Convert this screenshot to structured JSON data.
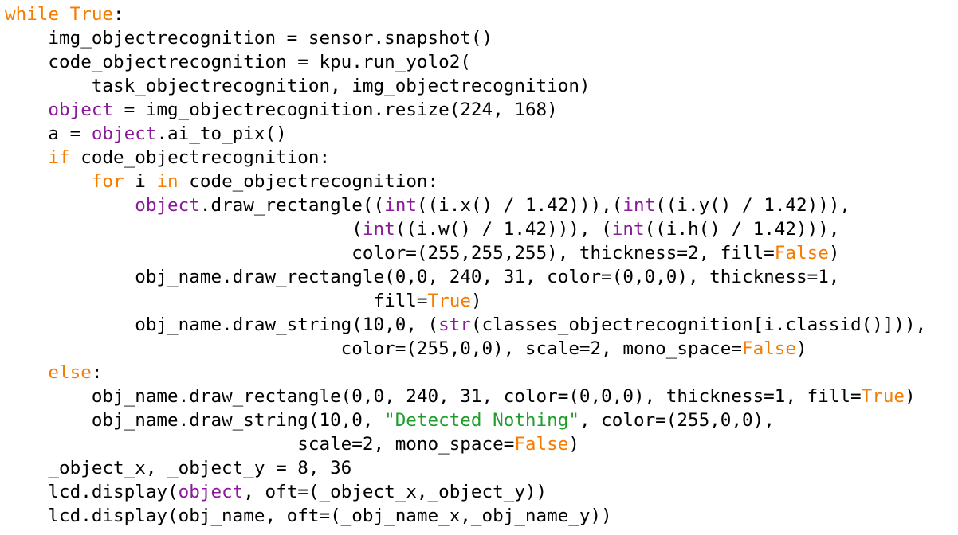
{
  "colors": {
    "keyword": "#f57c00",
    "builtin": "#8b1a9b",
    "string": "#1f9e2a",
    "plain": "#000000",
    "background": "#ffffff"
  },
  "lines": [
    [
      {
        "t": "while True",
        "k": "keyword"
      },
      {
        "t": ":",
        "k": "plain"
      }
    ],
    [
      {
        "t": "    img_objectrecognition = sensor.snapshot()",
        "k": "plain"
      }
    ],
    [
      {
        "t": "    code_objectrecognition = kpu.run_yolo2(",
        "k": "plain"
      }
    ],
    [
      {
        "t": "        task_objectrecognition, img_objectrecognition)",
        "k": "plain"
      }
    ],
    [
      {
        "t": "    ",
        "k": "plain"
      },
      {
        "t": "object",
        "k": "builtin"
      },
      {
        "t": " = img_objectrecognition.resize(224, 168)",
        "k": "plain"
      }
    ],
    [
      {
        "t": "    a = ",
        "k": "plain"
      },
      {
        "t": "object",
        "k": "builtin"
      },
      {
        "t": ".ai_to_pix()",
        "k": "plain"
      }
    ],
    [
      {
        "t": "    ",
        "k": "plain"
      },
      {
        "t": "if",
        "k": "keyword"
      },
      {
        "t": " code_objectrecognition:",
        "k": "plain"
      }
    ],
    [
      {
        "t": "        ",
        "k": "plain"
      },
      {
        "t": "for",
        "k": "keyword"
      },
      {
        "t": " i ",
        "k": "plain"
      },
      {
        "t": "in",
        "k": "keyword"
      },
      {
        "t": " code_objectrecognition:",
        "k": "plain"
      }
    ],
    [
      {
        "t": "            ",
        "k": "plain"
      },
      {
        "t": "object",
        "k": "builtin"
      },
      {
        "t": ".draw_rectangle((",
        "k": "plain"
      },
      {
        "t": "int",
        "k": "builtin"
      },
      {
        "t": "((i.x() / 1.42))),(",
        "k": "plain"
      },
      {
        "t": "int",
        "k": "builtin"
      },
      {
        "t": "((i.y() / 1.42))),",
        "k": "plain"
      }
    ],
    [
      {
        "t": "                                (",
        "k": "plain"
      },
      {
        "t": "int",
        "k": "builtin"
      },
      {
        "t": "((i.w() / 1.42))), (",
        "k": "plain"
      },
      {
        "t": "int",
        "k": "builtin"
      },
      {
        "t": "((i.h() / 1.42))),",
        "k": "plain"
      }
    ],
    [
      {
        "t": "                                color=(255,255,255), thickness=2, fill=",
        "k": "plain"
      },
      {
        "t": "False",
        "k": "keyword"
      },
      {
        "t": ")",
        "k": "plain"
      }
    ],
    [
      {
        "t": "            obj_name.draw_rectangle(0,0, 240, 31, color=(0,0,0), thickness=1,",
        "k": "plain"
      }
    ],
    [
      {
        "t": "                                  fill=",
        "k": "plain"
      },
      {
        "t": "True",
        "k": "keyword"
      },
      {
        "t": ")",
        "k": "plain"
      }
    ],
    [
      {
        "t": "            obj_name.draw_string(10,0, (",
        "k": "plain"
      },
      {
        "t": "str",
        "k": "builtin"
      },
      {
        "t": "(classes_objectrecognition[i.classid()])),",
        "k": "plain"
      }
    ],
    [
      {
        "t": "                               color=(255,0,0), scale=2, mono_space=",
        "k": "plain"
      },
      {
        "t": "False",
        "k": "keyword"
      },
      {
        "t": ")",
        "k": "plain"
      }
    ],
    [
      {
        "t": "    ",
        "k": "plain"
      },
      {
        "t": "else",
        "k": "keyword"
      },
      {
        "t": ":",
        "k": "plain"
      }
    ],
    [
      {
        "t": "        obj_name.draw_rectangle(0,0, 240, 31, color=(0,0,0), thickness=1, fill=",
        "k": "plain"
      },
      {
        "t": "True",
        "k": "keyword"
      },
      {
        "t": ")",
        "k": "plain"
      }
    ],
    [
      {
        "t": "        obj_name.draw_string(10,0, ",
        "k": "plain"
      },
      {
        "t": "\"Detected Nothing\"",
        "k": "string"
      },
      {
        "t": ", color=(255,0,0),",
        "k": "plain"
      }
    ],
    [
      {
        "t": "                           scale=2, mono_space=",
        "k": "plain"
      },
      {
        "t": "False",
        "k": "keyword"
      },
      {
        "t": ")",
        "k": "plain"
      }
    ],
    [
      {
        "t": "    _object_x, _object_y = 8, 36",
        "k": "plain"
      }
    ],
    [
      {
        "t": "    lcd.display(",
        "k": "plain"
      },
      {
        "t": "object",
        "k": "builtin"
      },
      {
        "t": ", oft=(_object_x,_object_y))",
        "k": "plain"
      }
    ],
    [
      {
        "t": "    lcd.display(obj_name, oft=(_obj_name_x,_obj_name_y))",
        "k": "plain"
      }
    ]
  ]
}
